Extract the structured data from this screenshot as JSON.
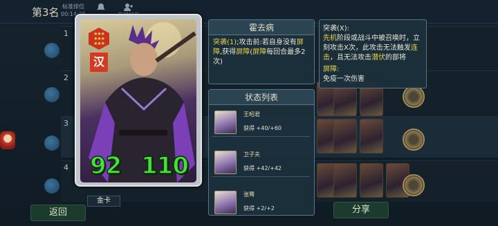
{
  "header": {
    "rank_label": "第3名",
    "cols": [
      {
        "label": "标准排位",
        "value": "00:14:25"
      },
      {
        "label": "",
        "value": ""
      },
      {
        "label": "在线好友",
        "value": ""
      }
    ]
  },
  "board": {
    "rows": [
      {
        "num": "1"
      },
      {
        "num": "2"
      },
      {
        "num": "3"
      },
      {
        "num": "4"
      }
    ]
  },
  "card": {
    "faction_char": "汉",
    "attack": "92",
    "health": "110",
    "rarity_label": "金卡"
  },
  "skill": {
    "hero_name": "霍去病",
    "prefix": "突袭(1)",
    "text_a": ";攻击前:若自身没有",
    "kw_shield_1": "屏障",
    "text_b": ",获得",
    "kw_shield_2": "屏障",
    "text_c": "(",
    "kw_shield_3": "屏障",
    "text_d": "每回合最多2次)"
  },
  "status": {
    "title": "状态列表",
    "items": [
      {
        "name": "王昭君",
        "gain": "获得 +40/+60"
      },
      {
        "name": "卫子夫",
        "gain": "获得 +42/+42"
      },
      {
        "name": "张骞",
        "gain": "获得 +2/+2"
      }
    ]
  },
  "keywords": {
    "raid_title": "突袭(X):",
    "raid_a": "先机",
    "raid_b": "阶段或战斗中被召唤时，立刻攻击X次，此攻击无法触发",
    "raid_c": "连击",
    "raid_d": "，且无法攻击",
    "raid_e": "潜伏",
    "raid_f": "的部将",
    "shield_title": "屏障:",
    "shield_desc": "免疫一次伤害"
  },
  "buttons": {
    "back_label": "返回",
    "share_label": "分享"
  },
  "colors": {
    "keyword": "#e8d24a",
    "stat_green": "#45e03a",
    "panel_bg": "#1c303c"
  }
}
